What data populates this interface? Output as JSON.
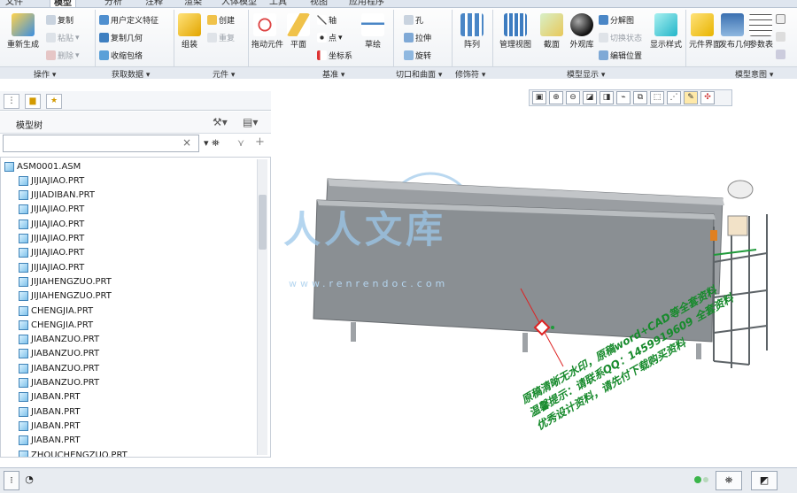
{
  "ribbon": {
    "tabs": [
      "文件",
      "模型",
      "分析",
      "注释",
      "渲染",
      "人体模型",
      "工具",
      "视图",
      "应用程序"
    ],
    "active_tab": "模型",
    "groups": {
      "operations": "操作 ▾",
      "get_data": "获取数据 ▾",
      "element": "元件 ▾",
      "datum": "基准 ▾",
      "cut_surface": "切口和曲面 ▾",
      "modifier": "修饰符 ▾",
      "model_display": "模型显示 ▾",
      "model_intent": "模型意图 ▾"
    },
    "buttons": {
      "regenerate": "重新生成",
      "copy": "复制",
      "paste": "粘贴",
      "delete": "删除",
      "user_defined_feature": "用户定义特征",
      "copy_geometry": "复制几何",
      "shrinkwrap": "收缩包络",
      "assemble": "组装",
      "create": "创建",
      "repeat": "重复",
      "drag": "拖动元件",
      "plane": "平面",
      "axis": "轴",
      "point": "点",
      "csys": "坐标系",
      "sketch": "草绘",
      "hole": "孔",
      "extrude": "拉伸",
      "revolve": "旋转",
      "pattern": "阵列",
      "manage_views": "管理视图",
      "section": "截面",
      "appearance": "外观库",
      "exploded_view": "分解图",
      "toggle_status": "切换状态",
      "edit_position": "编辑位置",
      "display_style": "显示样式",
      "component_interface": "元件界面",
      "publish_geometry": "发布几何",
      "parameters": "参数表"
    }
  },
  "left_panel": {
    "header": "模型树",
    "filter_clear": "×",
    "filter_value": "",
    "tree": [
      "ASM0001.ASM",
      "JIJIAJIAO.PRT",
      "JIJIADIBAN.PRT",
      "JIJIAJIAO.PRT",
      "JIJIAJIAO.PRT",
      "JIJIAJIAO.PRT",
      "JIJIAJIAO.PRT",
      "JIJIAJIAO.PRT",
      "JIJIAHENGZUO.PRT",
      "JIJIAHENGZUO.PRT",
      "CHENGJIA.PRT",
      "CHENGJIA.PRT",
      "JIABANZUO.PRT",
      "JIABANZUO.PRT",
      "JIABANZUO.PRT",
      "JIABANZUO.PRT",
      "JIABAN.PRT",
      "JIABAN.PRT",
      "JIABAN.PRT",
      "JIABAN.PRT",
      "ZHOUCHENGZUO.PRT"
    ]
  },
  "graphics": {
    "watermark_cn": "人人文库",
    "watermark_url": "www.renrendoc.com",
    "promo_lines": [
      "原稿清晰无水印，原稿word+CAD等全套资料",
      "温馨提示：请联系QQ：1459919609 全套资料",
      "优秀设计资料，请先付下载购买资料"
    ]
  },
  "colors": {
    "accent": "#2f6fb3",
    "model_body": "#8a8f93",
    "model_top": "#b9bdc0",
    "frame_green": "#1f9a3a",
    "promo_green": "#178a2c",
    "watermark_blue": "#9cc7ea"
  }
}
